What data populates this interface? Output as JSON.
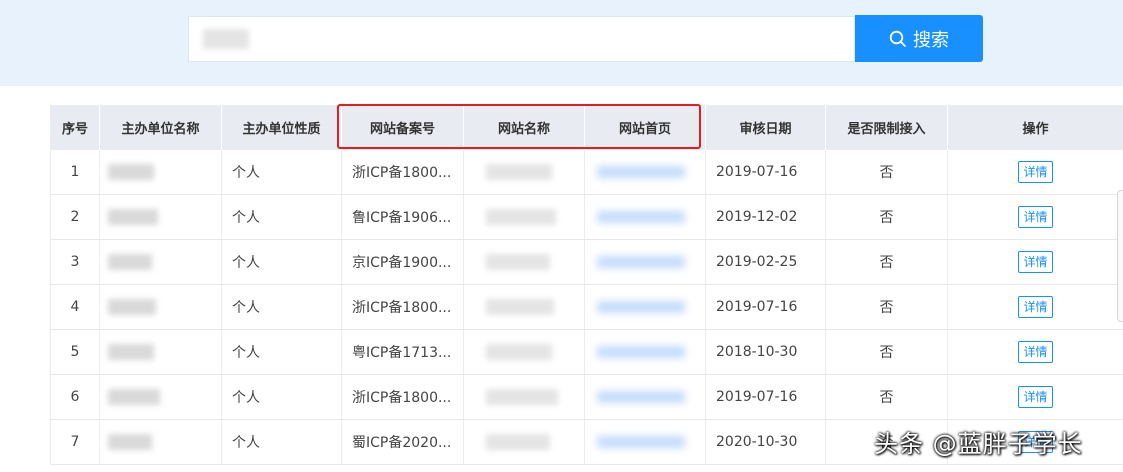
{
  "search": {
    "placeholder": "",
    "button_label": "搜索",
    "button_icon": "search-icon"
  },
  "table": {
    "columns": [
      "序号",
      "主办单位名称",
      "主办单位性质",
      "网站备案号",
      "网站名称",
      "网站首页",
      "审核日期",
      "是否限制接入",
      "操作"
    ],
    "rows": [
      {
        "index": "1",
        "nature": "个人",
        "icp": "浙ICP备1800...",
        "date": "2019-07-16",
        "restricted": "否",
        "action": "详情"
      },
      {
        "index": "2",
        "nature": "个人",
        "icp": "鲁ICP备1906...",
        "date": "2019-12-02",
        "restricted": "否",
        "action": "详情"
      },
      {
        "index": "3",
        "nature": "个人",
        "icp": "京ICP备1900...",
        "date": "2019-02-25",
        "restricted": "否",
        "action": "详情"
      },
      {
        "index": "4",
        "nature": "个人",
        "icp": "浙ICP备1800...",
        "date": "2019-07-16",
        "restricted": "否",
        "action": "详情"
      },
      {
        "index": "5",
        "nature": "个人",
        "icp": "粤ICP备1713...",
        "date": "2018-10-30",
        "restricted": "否",
        "action": "详情"
      },
      {
        "index": "6",
        "nature": "个人",
        "icp": "浙ICP备1800...",
        "date": "2019-07-16",
        "restricted": "否",
        "action": "详情"
      },
      {
        "index": "7",
        "nature": "个人",
        "icp": "蜀ICP备2020...",
        "date": "2020-10-30",
        "restricted": "否",
        "action": "详情"
      }
    ]
  },
  "annotation": {
    "highlight_color": "#e02020"
  },
  "watermark": "头条 @蓝胖子学长",
  "colors": {
    "accent": "#1890ff",
    "header_bg": "#e8ebf2",
    "search_band_bg": "#e8f2fd"
  }
}
